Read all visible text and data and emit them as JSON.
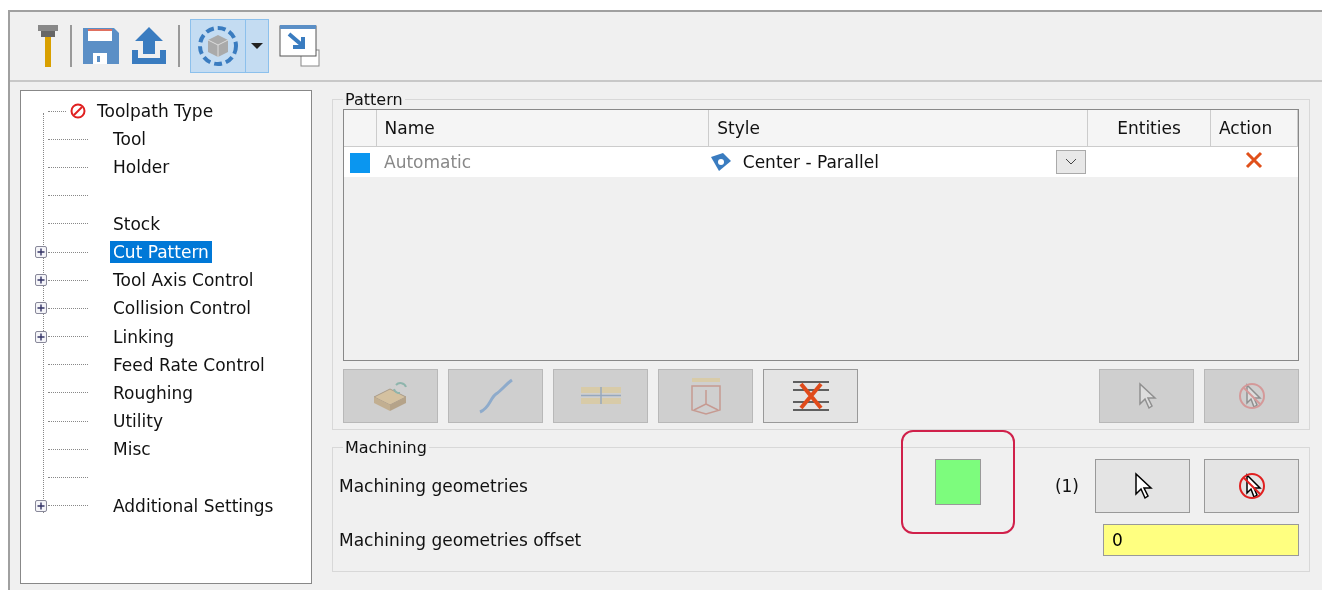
{
  "toolbar": {
    "view_toggle": {
      "selected": true
    }
  },
  "tree": {
    "items": [
      {
        "kind": "error",
        "label": "Toolpath Type",
        "expandable": false,
        "selected": false
      },
      {
        "kind": "plain",
        "label": "Tool",
        "expandable": false,
        "selected": false
      },
      {
        "kind": "plain",
        "label": "Holder",
        "expandable": false,
        "selected": false
      },
      {
        "kind": "spacer"
      },
      {
        "kind": "plain",
        "label": "Stock",
        "expandable": false,
        "selected": false
      },
      {
        "kind": "plain",
        "label": "Cut Pattern",
        "expandable": true,
        "selected": true
      },
      {
        "kind": "plain",
        "label": "Tool Axis Control",
        "expandable": true,
        "selected": false
      },
      {
        "kind": "plain",
        "label": "Collision Control",
        "expandable": true,
        "selected": false
      },
      {
        "kind": "plain",
        "label": "Linking",
        "expandable": true,
        "selected": false
      },
      {
        "kind": "plain",
        "label": "Feed Rate Control",
        "expandable": false,
        "selected": false
      },
      {
        "kind": "plain",
        "label": "Roughing",
        "expandable": false,
        "selected": false
      },
      {
        "kind": "plain",
        "label": "Utility",
        "expandable": false,
        "selected": false
      },
      {
        "kind": "plain",
        "label": "Misc",
        "expandable": false,
        "selected": false
      },
      {
        "kind": "spacer"
      },
      {
        "kind": "plain",
        "label": "Additional Settings",
        "expandable": true,
        "selected": false
      }
    ]
  },
  "pattern": {
    "title": "Pattern",
    "columns": [
      "Name",
      "Style",
      "Entities",
      "Action"
    ],
    "rows": [
      {
        "color": "#0a96f0",
        "name": "Automatic",
        "style": "Center - Parallel"
      }
    ],
    "buttons": [
      {
        "kind": "boxes",
        "disabled": true
      },
      {
        "kind": "curve",
        "disabled": true
      },
      {
        "kind": "bars",
        "disabled": true
      },
      {
        "kind": "cube",
        "disabled": true
      },
      {
        "kind": "delete",
        "disabled": false
      }
    ],
    "right_buttons": [
      {
        "kind": "pointer",
        "disabled": true
      },
      {
        "kind": "no-pointer",
        "disabled": true
      }
    ]
  },
  "machining": {
    "title": "Machining",
    "geometries": {
      "label": "Machining geometries",
      "color": "#7dfc7d",
      "count": "(1)",
      "buttons": [
        {
          "kind": "pointer",
          "disabled": false
        },
        {
          "kind": "no-pointer",
          "disabled": false
        }
      ]
    },
    "offset": {
      "label": "Machining geometries offset",
      "value": "0"
    }
  }
}
